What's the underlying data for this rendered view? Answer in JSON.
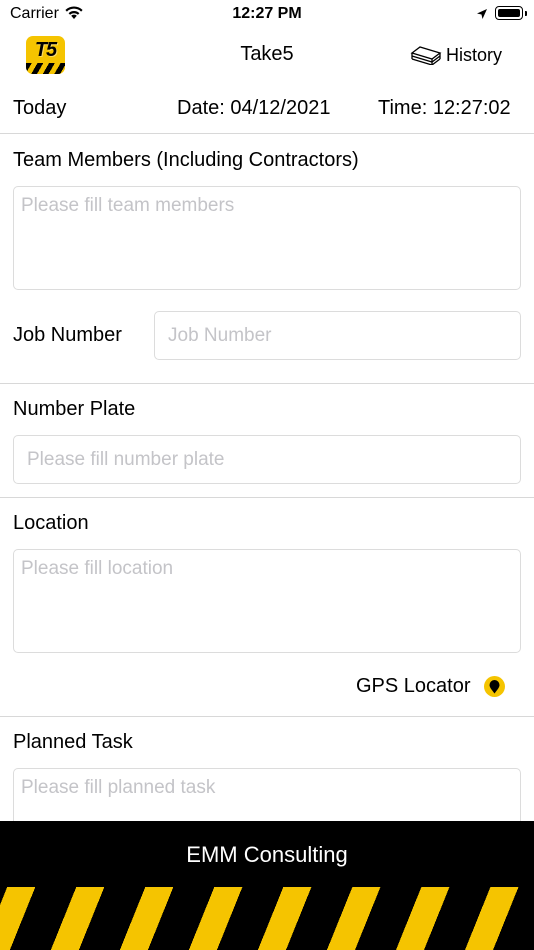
{
  "status_bar": {
    "carrier": "Carrier",
    "time": "12:27 PM"
  },
  "nav": {
    "title": "Take5",
    "logo_text": "T5",
    "history_label": "History"
  },
  "meta": {
    "today_label": "Today",
    "date_text": "Date: 04/12/2021",
    "time_text": "Time: 12:27:02"
  },
  "form": {
    "team_members": {
      "label": "Team Members (Including Contractors)",
      "placeholder": "Please fill team members",
      "value": ""
    },
    "job_number": {
      "label": "Job Number",
      "placeholder": "Job Number",
      "value": ""
    },
    "number_plate": {
      "label": "Number Plate",
      "placeholder": "Please fill number plate",
      "value": ""
    },
    "location": {
      "label": "Location",
      "placeholder": "Please fill location",
      "value": ""
    },
    "gps_locator_label": "GPS Locator",
    "planned_task": {
      "label": "Planned Task",
      "placeholder": "Please fill planned task",
      "value": ""
    }
  },
  "footer": {
    "label": "EMM Consulting"
  },
  "colors": {
    "accent": "#f5c400",
    "footer_bg": "#000000",
    "placeholder": "#c4c4c8",
    "border": "#dcdcdc"
  },
  "icons": {
    "wifi": "wifi-icon",
    "location_services": "location-arrow-icon",
    "battery": "battery-icon",
    "history": "stacked-papers-icon",
    "gps": "map-pin-icon"
  }
}
